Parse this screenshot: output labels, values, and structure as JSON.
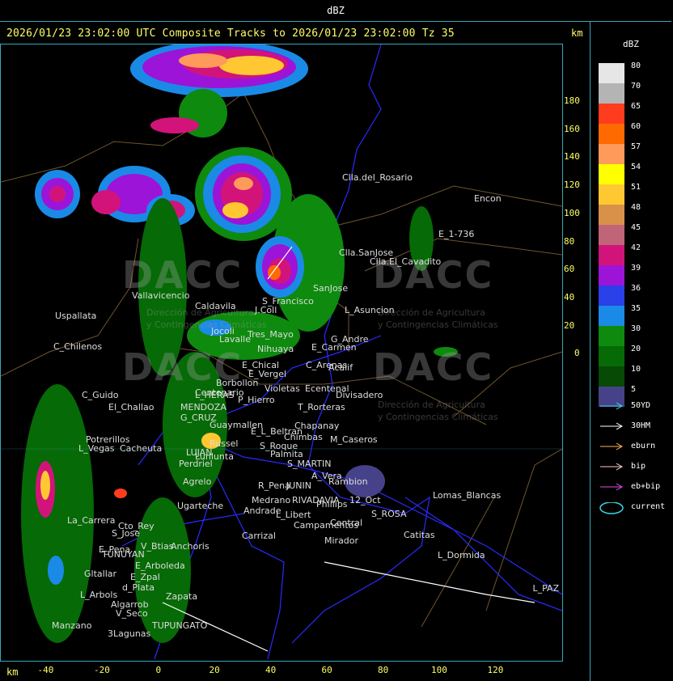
{
  "window": {
    "title": "dBZ"
  },
  "header": {
    "text": "2026/01/23 23:02:00 UTC Composite Tracks to 2026/01/23 23:02:00 Tz 35",
    "km_label": "km"
  },
  "axes": {
    "y_ticks": [
      "180",
      "160",
      "140",
      "120",
      "100",
      "80",
      "60",
      "40",
      "20",
      "0"
    ],
    "x_ticks": [
      "-40",
      "-20",
      "0",
      "20",
      "40",
      "60",
      "80",
      "100",
      "120"
    ],
    "x_unit": "km"
  },
  "legend": {
    "title": "dBZ",
    "scale": [
      {
        "label": "80",
        "color": "#e6e6e6"
      },
      {
        "label": "70",
        "color": "#b4b4b4"
      },
      {
        "label": "65",
        "color": "#ff3c1e"
      },
      {
        "label": "60",
        "color": "#ff6a00"
      },
      {
        "label": "57",
        "color": "#ff9a5a"
      },
      {
        "label": "54",
        "color": "#ffff00"
      },
      {
        "label": "51",
        "color": "#ffc832"
      },
      {
        "label": "48",
        "color": "#d9914a"
      },
      {
        "label": "45",
        "color": "#c06478"
      },
      {
        "label": "42",
        "color": "#d2147a"
      },
      {
        "label": "39",
        "color": "#9c14d8"
      },
      {
        "label": "36",
        "color": "#2a40e8"
      },
      {
        "label": "35",
        "color": "#1a8ae6"
      },
      {
        "label": "30",
        "color": "#0e8a0e"
      },
      {
        "label": "20",
        "color": "#066a06"
      },
      {
        "label": "10",
        "color": "#064a06"
      },
      {
        "label": "5",
        "color": "#46428a"
      }
    ],
    "tracks": [
      {
        "label": "50YD",
        "color": "#3ad6e6"
      },
      {
        "label": "30HM",
        "color": "#ffffff"
      },
      {
        "label": "eburn",
        "color": "#ffb25a"
      },
      {
        "label": "bip",
        "color": "#ffc8c8"
      },
      {
        "label": "eb+bip",
        "color": "#e64ae6"
      },
      {
        "label": "current",
        "color": "#3ad6e6"
      }
    ]
  },
  "watermark": {
    "brand": "DACC",
    "line1": "Dirección de Agricultura",
    "line2": "y Contingencias Climáticas"
  },
  "places": [
    {
      "name": "Clla.del_Rosario"
    },
    {
      "name": "Encon"
    },
    {
      "name": "E_1-736"
    },
    {
      "name": "Clla.SanJose"
    },
    {
      "name": "Clla.El_Cavadito"
    },
    {
      "name": "Vallavicencio"
    },
    {
      "name": "Uspallata"
    },
    {
      "name": "C_Chilenos"
    },
    {
      "name": "Caldavila"
    },
    {
      "name": "S_Francisco"
    },
    {
      "name": "SanJose"
    },
    {
      "name": "L_Asuncion"
    },
    {
      "name": "J.Coll"
    },
    {
      "name": "Tres_Mayo"
    },
    {
      "name": "G_Andre"
    },
    {
      "name": "Jocoli"
    },
    {
      "name": "Lavalle"
    },
    {
      "name": "Nihuaya"
    },
    {
      "name": "E_Carmen"
    },
    {
      "name": "E_Chical"
    },
    {
      "name": "E_Vergel"
    },
    {
      "name": "C_Arenas"
    },
    {
      "name": "Acalif"
    },
    {
      "name": "Borbollon"
    },
    {
      "name": "Centenario"
    },
    {
      "name": "P_Hierro"
    },
    {
      "name": "Ecentenal"
    },
    {
      "name": "Divisadero"
    },
    {
      "name": "C_Guido"
    },
    {
      "name": "L_HERAS"
    },
    {
      "name": "Violetas"
    },
    {
      "name": "El_Challao"
    },
    {
      "name": "MENDOZA"
    },
    {
      "name": "T_Rorteras"
    },
    {
      "name": "G_CRUZ"
    },
    {
      "name": "Guaymallen"
    },
    {
      "name": "Chapanay"
    },
    {
      "name": "Potrerillos"
    },
    {
      "name": "L_Vegas"
    },
    {
      "name": "Cacheuta"
    },
    {
      "name": "E_L_Beltran"
    },
    {
      "name": "Chimbas"
    },
    {
      "name": "M_Caseros"
    },
    {
      "name": "Russel"
    },
    {
      "name": "S_Roque"
    },
    {
      "name": "LUJAN"
    },
    {
      "name": "Lunlunta"
    },
    {
      "name": "Palmita"
    },
    {
      "name": "Perdriel"
    },
    {
      "name": "S_MARTIN"
    },
    {
      "name": "A_Vera"
    },
    {
      "name": "Rambion"
    },
    {
      "name": "Agrelo"
    },
    {
      "name": "R_Pena"
    },
    {
      "name": "JUNIN"
    },
    {
      "name": "Ugarteche"
    },
    {
      "name": "Medrano"
    },
    {
      "name": "RIVADAVIA"
    },
    {
      "name": "Phillips"
    },
    {
      "name": "12_Oct"
    },
    {
      "name": "Lomas_Blancas"
    },
    {
      "name": "La_Carrera"
    },
    {
      "name": "Cto_Rey"
    },
    {
      "name": "S_Jose"
    },
    {
      "name": "Andrade"
    },
    {
      "name": "L_Libert"
    },
    {
      "name": "S_ROSA"
    },
    {
      "name": "Carrizal"
    },
    {
      "name": "Campamentos"
    },
    {
      "name": "Central"
    },
    {
      "name": "Catitas"
    },
    {
      "name": "V_Btias"
    },
    {
      "name": "E_Pena"
    },
    {
      "name": "TUNUYAN"
    },
    {
      "name": "Anchoris"
    },
    {
      "name": "Mirador"
    },
    {
      "name": "L_Dormida"
    },
    {
      "name": "E_Arboleda"
    },
    {
      "name": "Gltallar"
    },
    {
      "name": "E_Zpal"
    },
    {
      "name": "d_Plata"
    },
    {
      "name": "L_Arbols"
    },
    {
      "name": "Zapata"
    },
    {
      "name": "L_PAZ"
    },
    {
      "name": "Algarrob"
    },
    {
      "name": "V_Seco"
    },
    {
      "name": "Manzano"
    },
    {
      "name": "TUPUNGATO"
    },
    {
      "name": "3Lagunas"
    }
  ]
}
